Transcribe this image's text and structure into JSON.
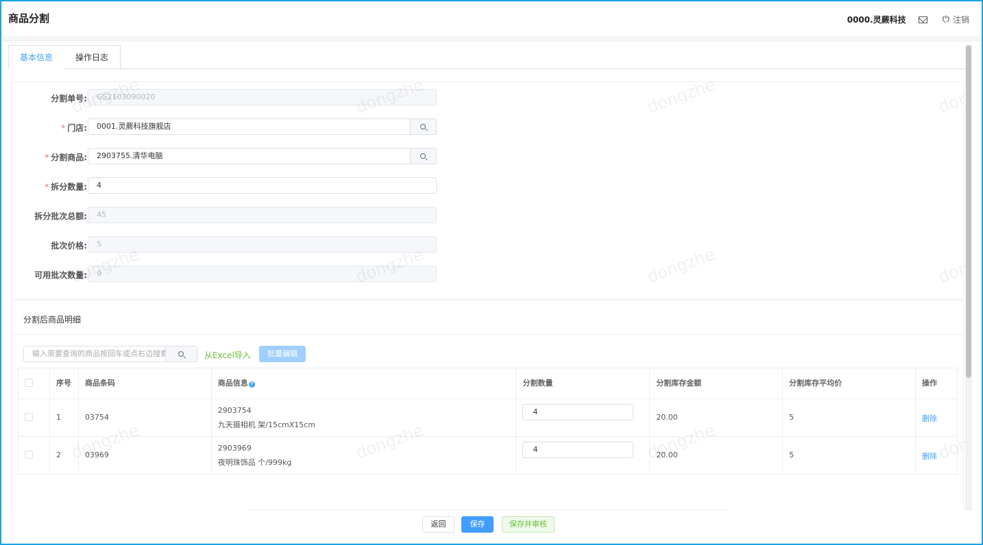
{
  "header": {
    "title": "商品分割",
    "company": "0000.灵蕨科技",
    "logout_label": "注销"
  },
  "tabs": [
    {
      "label": "基本信息"
    },
    {
      "label": "操作日志"
    }
  ],
  "form": {
    "split_no": {
      "label": "分割单号:",
      "value": "GS2103090020"
    },
    "store": {
      "label": "门店:",
      "value": "0001.灵蕨科技旗舰店"
    },
    "product": {
      "label": "分割商品:",
      "value": "2903755.清华电脑"
    },
    "split_qty": {
      "label": "拆分数量:",
      "value": "4"
    },
    "batch_total": {
      "label": "拆分批次总额:",
      "value": "45"
    },
    "batch_price": {
      "label": "批次价格:",
      "value": "5"
    },
    "available_qty": {
      "label": "可用批次数量:",
      "value": "9"
    }
  },
  "detail": {
    "title": "分割后商品明细",
    "search_placeholder": "输入需要查询的商品按回车或点右边搜索",
    "excel_import_label": "从Excel导入",
    "batch_edit_label": "批量编辑",
    "columns": [
      "序号",
      "商品条码",
      "商品信息",
      "分割数量",
      "分割库存金额",
      "分割库存平均价",
      "操作"
    ],
    "help_glyph": "?",
    "rows": [
      {
        "index": "1",
        "barcode": "03754",
        "info_code": "2903754",
        "info_name": "九天摄相机 架/15cmX15cm",
        "qty": "4",
        "amount": "20.00",
        "avg_price": "5",
        "action": "删除"
      },
      {
        "index": "2",
        "barcode": "03969",
        "info_code": "2903969",
        "info_name": "夜明珠饰品 个/999kg",
        "qty": "4",
        "amount": "20.00",
        "avg_price": "5",
        "action": "删除"
      }
    ]
  },
  "footer": {
    "back_label": "返回",
    "save_label": "保存",
    "save_audit_label": "保存并审核"
  },
  "watermark": "dongzhe",
  "colors": {
    "primary": "#409eff",
    "success": "#67c23a",
    "required": "#f56c6c",
    "frame": "#1ba1e2"
  },
  "icons": [
    "mail-icon",
    "power-icon",
    "search-icon",
    "help-icon",
    "checkbox-icon"
  ]
}
